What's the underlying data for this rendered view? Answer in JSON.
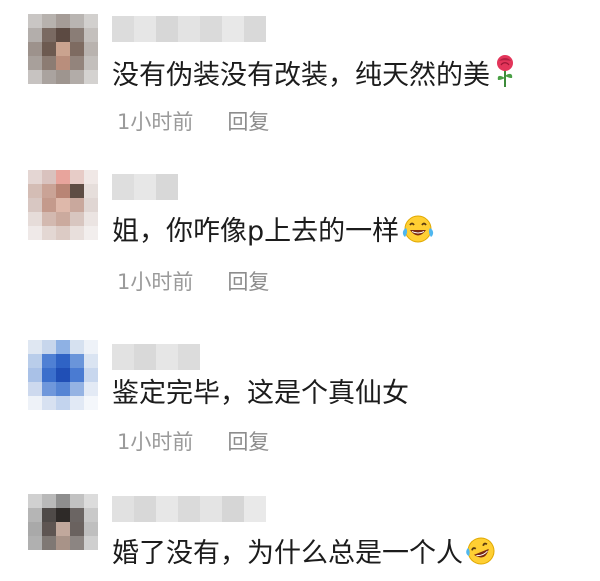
{
  "comments": [
    {
      "text": "没有伪装没有改装，纯天然的美",
      "time": "1小时前",
      "reply": "回复",
      "emoji": "rose-icon"
    },
    {
      "text": "姐，你咋像p上去的一样",
      "time": "1小时前",
      "reply": "回复",
      "emoji": "laughing-tears-icon"
    },
    {
      "text": "鉴定完毕，这是个真仙女",
      "time": "1小时前",
      "reply": "回复",
      "emoji": ""
    },
    {
      "text": "婚了没有，为什么总是一个人",
      "time": "",
      "reply": "",
      "emoji": "rofl-icon"
    }
  ]
}
